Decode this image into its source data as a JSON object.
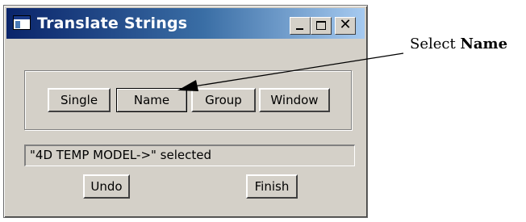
{
  "window": {
    "title": "Translate Strings",
    "controls": {
      "minimize": "minimize-icon",
      "maximize": "maximize-icon",
      "close": "close-icon"
    },
    "close_glyph": "✕"
  },
  "select_mode": {
    "buttons": [
      {
        "label": "Single"
      },
      {
        "label": "Name",
        "pressed": true
      },
      {
        "label": "Group"
      },
      {
        "label": "Window"
      }
    ]
  },
  "status": {
    "text": "\"4D TEMP MODEL->\" selected"
  },
  "actions": {
    "undo_label": "Undo",
    "finish_label": "Finish"
  },
  "annotation": {
    "prefix": "Select ",
    "bold": "Name"
  },
  "colors": {
    "title_start": "#0a246a",
    "title_end": "#a6caf0",
    "face": "#d4d0c8"
  }
}
